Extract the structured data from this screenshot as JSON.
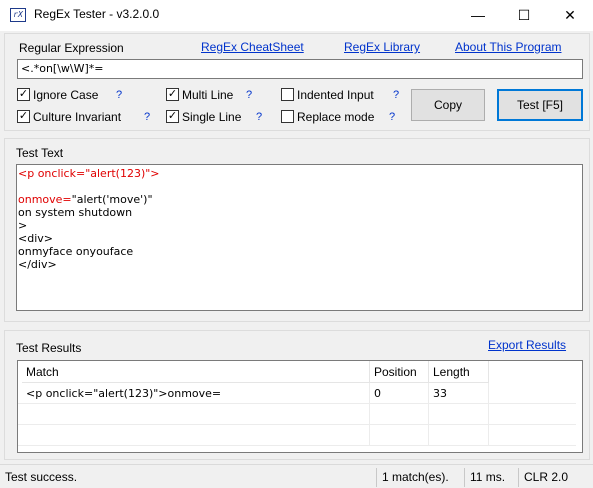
{
  "window": {
    "title": "RegEx Tester - v3.2.0.0",
    "icon_text": "rX",
    "minimize_glyph": "—",
    "maximize_glyph": "☐",
    "close_glyph": "✕"
  },
  "regex_group": {
    "label": "Regular Expression",
    "links": {
      "cheatsheet": "RegEx CheatSheet",
      "library": "RegEx Library",
      "about": "About This Program"
    },
    "pattern_value": "<.*on[\\w\\W]*=",
    "options": {
      "ignore_case": {
        "label": "Ignore Case",
        "checked": true,
        "mark": "✓"
      },
      "culture_invariant": {
        "label": "Culture Invariant",
        "checked": true,
        "mark": "✓"
      },
      "multi_line": {
        "label": "Multi Line",
        "checked": true,
        "mark": "✓"
      },
      "single_line": {
        "label": "Single Line",
        "checked": true,
        "mark": "✓"
      },
      "indented_input": {
        "label": "Indented Input",
        "checked": false,
        "mark": ""
      },
      "replace_mode": {
        "label": "Replace mode",
        "checked": false,
        "mark": ""
      }
    },
    "help_glyph": "?",
    "copy_button": "Copy",
    "test_button": "Test [F5]"
  },
  "test_text": {
    "label": "Test Text",
    "lines": [
      "<p onclick=\"alert(123)\">",
      "",
      "onmove=\"alert('move')\"",
      "on system shutdown",
      ">",
      "<div>",
      "onmyface onyouface",
      "</div>"
    ],
    "highlighted_prefix": {
      "line0": "<p onclick=\"alert(123)\">",
      "line2": "onmove="
    },
    "line2_rest": "\"alert('move')\""
  },
  "results": {
    "label": "Test Results",
    "export_link": "Export Results",
    "columns": [
      "Match",
      "Position",
      "Length"
    ],
    "rows": [
      {
        "match": "<p onclick=\"alert(123)\">onmove=",
        "position": "0",
        "length": "33"
      }
    ]
  },
  "status": {
    "message": "Test success.",
    "matches": "1 match(es).",
    "time": "11 ms.",
    "clr": "CLR 2.0"
  },
  "colors": {
    "link": "#0033cc",
    "highlight": "#e00000",
    "accent_border": "#0078d7"
  }
}
